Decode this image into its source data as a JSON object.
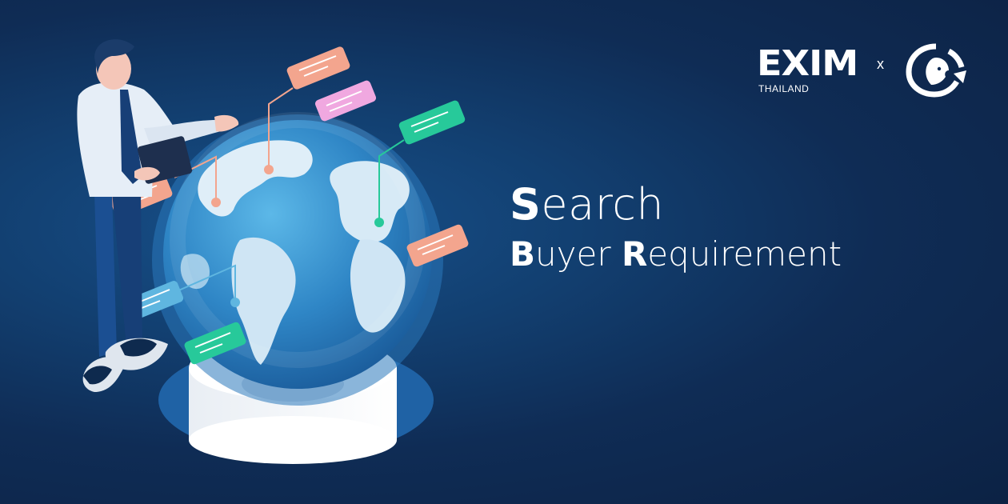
{
  "logos": {
    "primary_name": "EXIM",
    "primary_sub": "THAILAND",
    "separator": "x",
    "partner_icon": "circular-face-arrow-logo"
  },
  "headline": {
    "line1_initial": "S",
    "line1_rest": "earch",
    "line2_word1_initial": "B",
    "line2_word1_rest": "uyer ",
    "line2_word2_initial": "R",
    "line2_word2_rest": "equirement"
  },
  "illustration": {
    "subject": "businessman-presenting-globe",
    "callout_colors": [
      "#f3a58e",
      "#f0a8e0",
      "#27c99a",
      "#f3a58e",
      "#f3a58e",
      "#5fb6e0",
      "#27c99a"
    ]
  }
}
